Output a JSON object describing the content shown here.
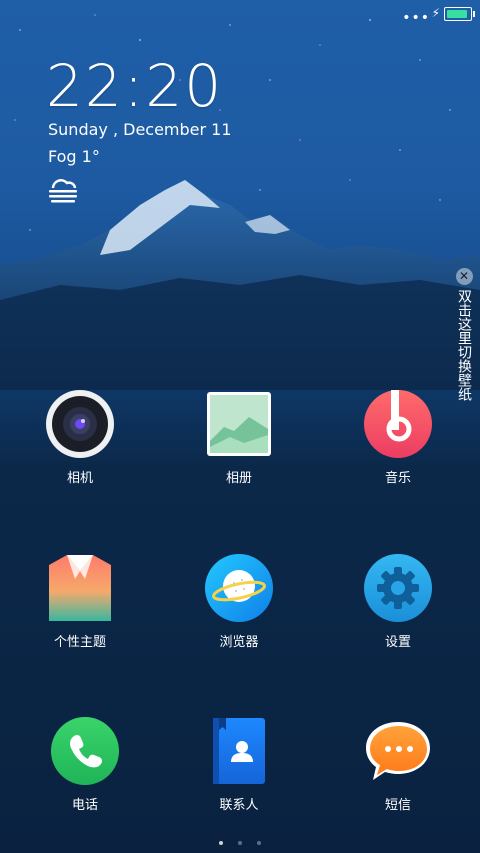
{
  "status": {
    "overflow": "•••",
    "charging_icon": "bolt-icon",
    "battery_color": "#35e0a0"
  },
  "clock": {
    "time": "22:20",
    "date": "Sunday , December 11",
    "weather": "Fog 1°"
  },
  "wallpaper_hint": {
    "close": "✕",
    "text": "双击这里切换壁纸"
  },
  "apps": [
    {
      "label": "相机",
      "icon": "camera-icon"
    },
    {
      "label": "相册",
      "icon": "gallery-icon"
    },
    {
      "label": "音乐",
      "icon": "music-icon"
    },
    {
      "label": "个性主题",
      "icon": "themes-icon"
    },
    {
      "label": "浏览器",
      "icon": "browser-icon"
    },
    {
      "label": "设置",
      "icon": "settings-icon"
    },
    {
      "label": "电话",
      "icon": "phone-icon"
    },
    {
      "label": "联系人",
      "icon": "contacts-icon"
    },
    {
      "label": "短信",
      "icon": "messages-icon"
    }
  ],
  "pager": {
    "pages": 3,
    "current": 1
  }
}
